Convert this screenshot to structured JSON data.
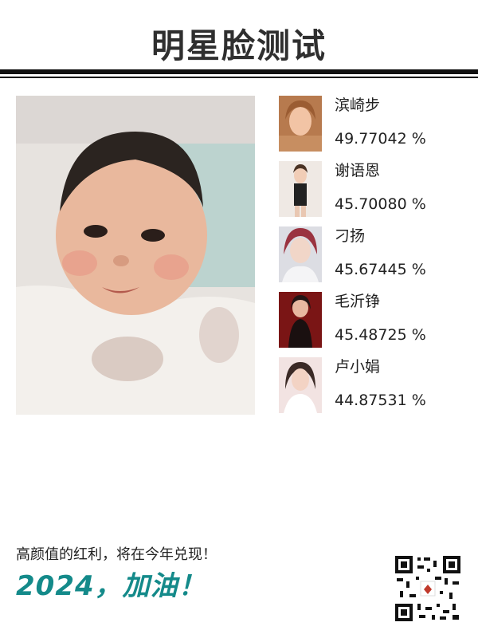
{
  "header": {
    "title": "明星脸测试"
  },
  "main_photo": {
    "description": "baby-portrait"
  },
  "results": [
    {
      "name": "滨崎步",
      "score": "49.77042 %",
      "thumb_color": "#b77a4e"
    },
    {
      "name": "谢语恩",
      "score": "45.70080 %",
      "thumb_color": "#efe9e4"
    },
    {
      "name": "刁扬",
      "score": "45.67445 %",
      "thumb_color": "#9a3340"
    },
    {
      "name": "毛沂铮",
      "score": "45.48725 %",
      "thumb_color": "#7a1515"
    },
    {
      "name": "卢小娟",
      "score": "44.87531 %",
      "thumb_color": "#f2e3e2"
    }
  ],
  "footer": {
    "tagline": "高颜值的红利，将在今年兑现！",
    "slogan": "2024，加油！"
  },
  "colors": {
    "accent": "#148a8a",
    "title": "#2f2f2f"
  }
}
